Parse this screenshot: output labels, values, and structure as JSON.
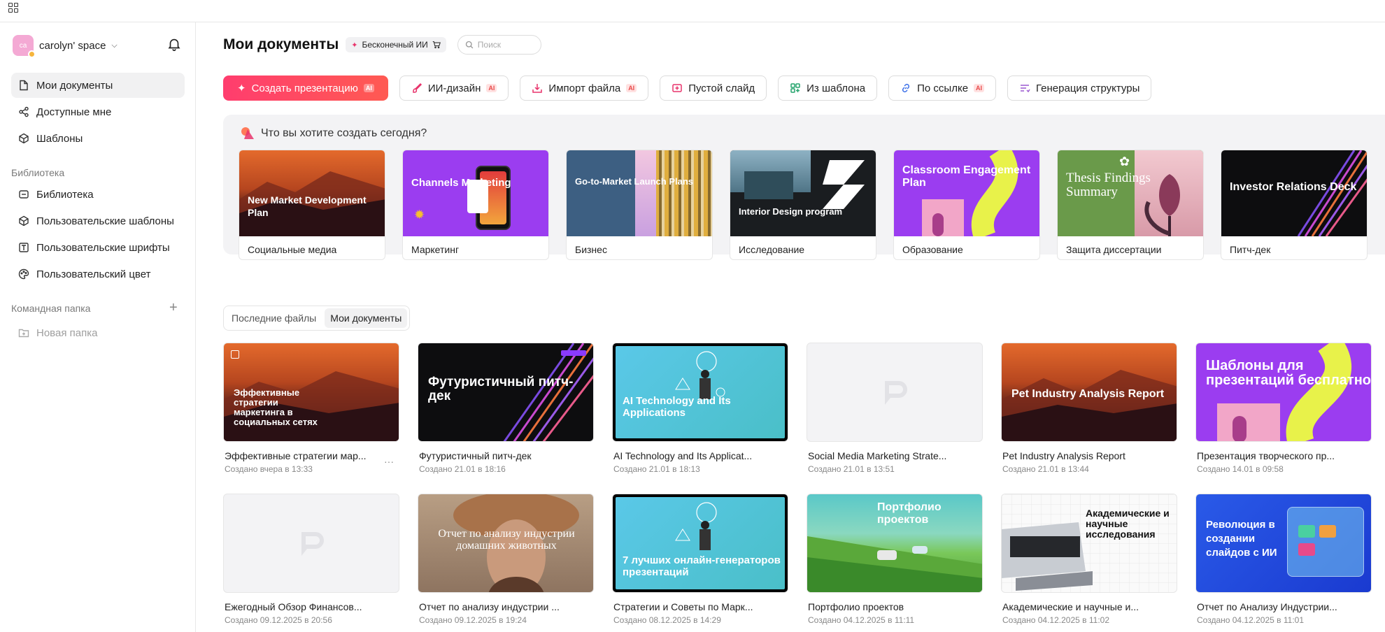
{
  "sidebar": {
    "space_name": "carolyn' space",
    "avatar_initials": "ca",
    "items": [
      {
        "label": "Мои документы",
        "icon": "file-icon"
      },
      {
        "label": "Доступные мне",
        "icon": "share-icon"
      },
      {
        "label": "Шаблоны",
        "icon": "template-icon"
      }
    ],
    "library_title": "Библиотека",
    "library_items": [
      {
        "label": "Библиотека",
        "icon": "library-icon"
      },
      {
        "label": "Пользовательские шаблоны",
        "icon": "cube-icon"
      },
      {
        "label": "Пользовательские шрифты",
        "icon": "font-icon"
      },
      {
        "label": "Пользовательский цвет",
        "icon": "palette-icon"
      }
    ],
    "team_title": "Командная папка",
    "new_folder": "Новая папка"
  },
  "header": {
    "title": "Мои документы",
    "badge": "Бесконечный ИИ",
    "search_placeholder": "Поиск"
  },
  "actions": {
    "create": "Создать презентацию",
    "ai_design": "ИИ-дизайн",
    "import": "Импорт файла",
    "blank": "Пустой слайд",
    "from_template": "Из шаблона",
    "by_link": "По ссылке",
    "outline": "Генерация структуры",
    "ai_tag": "AI"
  },
  "templates": {
    "prompt": "Что вы хотите создать сегодня?",
    "cards": [
      {
        "label": "Социальные медиа",
        "thumb_text": "New Market Development Plan"
      },
      {
        "label": "Маркетинг",
        "thumb_text": "Channels Marketing"
      },
      {
        "label": "Бизнес",
        "thumb_text": "Go-to-Market Launch Plans"
      },
      {
        "label": "Исследование",
        "thumb_text": "Interior Design program"
      },
      {
        "label": "Образование",
        "thumb_text": "Classroom Engagement Plan"
      },
      {
        "label": "Защита диссертации",
        "thumb_text": "Thesis Findings Summary"
      },
      {
        "label": "Питч-дек",
        "thumb_text": "Investor Relations Deck"
      }
    ]
  },
  "file_tabs": [
    "Последние файлы",
    "Мои документы"
  ],
  "files": [
    {
      "name": "Эффективные стратегии мар...",
      "date": "Создано вчера в 13:33",
      "thumb_text": "Эффективные стратегии маркетинга в социальных сетях"
    },
    {
      "name": "Футуристичный питч-дек",
      "date": "Создано 21.01 в 18:16",
      "thumb_text": "Футуристичный питч-дек"
    },
    {
      "name": "AI Technology and Its Applicat...",
      "date": "Создано 21.01 в 18:13",
      "thumb_text": "AI Technology and Its Applications"
    },
    {
      "name": "Social Media Marketing Strate...",
      "date": "Создано 21.01 в 13:51",
      "thumb_text": ""
    },
    {
      "name": "Pet Industry Analysis Report",
      "date": "Создано 21.01 в 13:44",
      "thumb_text": "Pet Industry Analysis Report"
    },
    {
      "name": "Презентация творческого пр...",
      "date": "Создано 14.01 в 09:58",
      "thumb_text": "Шаблоны для презентаций бесплатно"
    },
    {
      "name": "Ежегодный Обзор Финансов...",
      "date": "Создано 09.12.2025 в 20:56",
      "thumb_text": ""
    },
    {
      "name": "Отчет по анализу индустрии ...",
      "date": "Создано 09.12.2025 в 19:24",
      "thumb_text": "Отчет по анализу индустрии домашних животных"
    },
    {
      "name": "Стратегии и Советы по Марк...",
      "date": "Создано 08.12.2025 в 14:29",
      "thumb_text": "7 лучших онлайн-генераторов презентаций"
    },
    {
      "name": "Портфолио проектов",
      "date": "Создано 04.12.2025 в 11:11",
      "thumb_text": "Портфолио проектов"
    },
    {
      "name": "Академические и научные и...",
      "date": "Создано 04.12.2025 в 11:02",
      "thumb_text": "Академические и научные исследования"
    },
    {
      "name": "Отчет по Анализу Индустрии...",
      "date": "Создано 04.12.2025 в 11:01",
      "thumb_text": "Революция в создании слайдов с ИИ"
    }
  ],
  "more_label": "···",
  "colors": {
    "accent": "#ff3d6e",
    "muted": "#888888"
  }
}
